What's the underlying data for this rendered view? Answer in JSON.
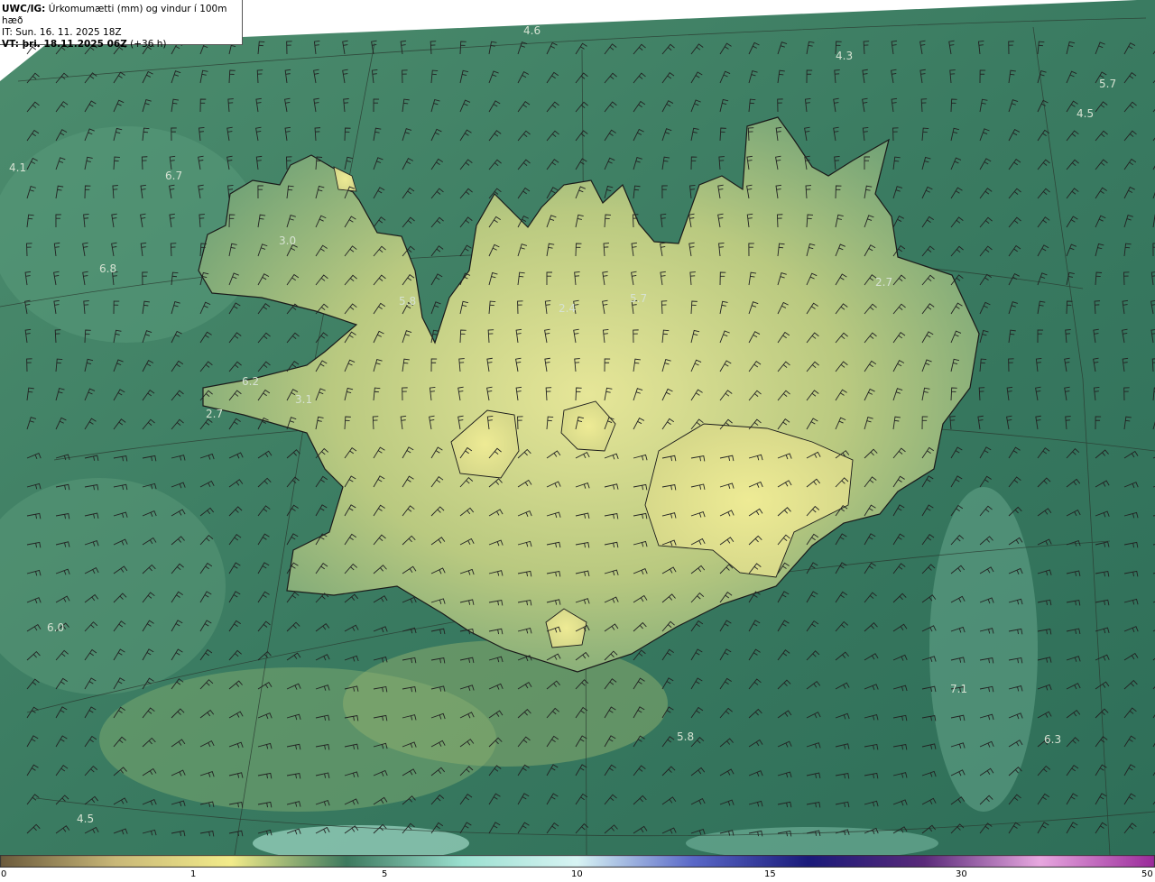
{
  "header": {
    "product_code": "UWC/IG:",
    "product_title": "Úrkomumætti (mm) og vindur í 100m hæð",
    "initial_time": "IT: Sun. 16. 11. 2025 18Z",
    "valid_prefix": "VT: þri. 18.11.2025 06Z",
    "valid_offset": "(+36 h)"
  },
  "map_labels": [
    {
      "text": "4.6"
    },
    {
      "text": "4.3"
    },
    {
      "text": "5.7"
    },
    {
      "text": "4.5"
    },
    {
      "text": "4.1"
    },
    {
      "text": "6.7"
    },
    {
      "text": "3.0"
    },
    {
      "text": "6.8"
    },
    {
      "text": "5.8"
    },
    {
      "text": "2.4"
    },
    {
      "text": "5.7"
    },
    {
      "text": "2.7"
    },
    {
      "text": "6.2"
    },
    {
      "text": "3.1"
    },
    {
      "text": "2.7"
    },
    {
      "text": "6.0"
    },
    {
      "text": "7.1"
    },
    {
      "text": "5.8"
    },
    {
      "text": "6.3"
    },
    {
      "text": "4.5"
    }
  ],
  "colorbar": {
    "ticks": [
      "0",
      "1",
      "5",
      "10",
      "15",
      "30",
      "50"
    ],
    "colors": [
      "#6b5a3c",
      "#c9b878",
      "#f3ec8a",
      "#3e7a5f",
      "#9be0d0",
      "#d8f4f4",
      "#5a68c8",
      "#1a1a7a",
      "#5a2a7a",
      "#e8a8e0",
      "#9a2a9a"
    ]
  },
  "colors": {
    "sea_dark": "#2f6a55",
    "sea_mid": "#3f8466",
    "land_light": "#d8dd8c",
    "coastline": "#1a1a1a"
  }
}
